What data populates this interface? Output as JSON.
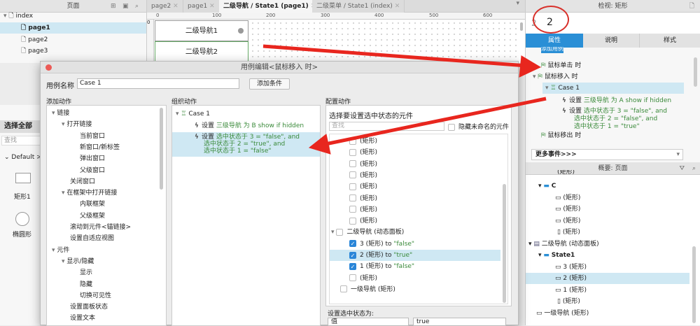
{
  "pages_panel": {
    "title": "页面",
    "tree": [
      {
        "label": "index"
      },
      {
        "label": "page1"
      },
      {
        "label": "page2"
      },
      {
        "label": "page3"
      }
    ]
  },
  "library_panel": {
    "select_all": "选择全部",
    "search_placeholder": "查找",
    "library": "Default >",
    "widgets": [
      {
        "label": "矩形1"
      },
      {
        "label": "椭圆形"
      }
    ]
  },
  "canvas": {
    "tabs": [
      {
        "label": "page2"
      },
      {
        "label": "page1"
      },
      {
        "label": "二级导航 / State1 (page1)"
      },
      {
        "label": "二级菜单 / State1 (index)"
      }
    ],
    "ruler": [
      "0",
      "100",
      "200",
      "300",
      "400",
      "500",
      "600"
    ],
    "v_ruler": "0",
    "widgets": [
      {
        "label": "二级导航1"
      },
      {
        "label": "二级导航2"
      }
    ]
  },
  "dialog": {
    "title": "用例编辑<鼠标移入 时>",
    "case_name_label": "用例名称",
    "case_name": "Case 1",
    "add_condition": "添加条件",
    "add_actions": {
      "title": "添加动作",
      "items": [
        "链接",
        "打开链接",
        "当前窗口",
        "新窗口/新标签",
        "弹出窗口",
        "父级窗口",
        "关闭窗口",
        "在框架中打开链接",
        "内联框架",
        "父级框架",
        "滚动到元件<锚链接>",
        "设置自适应视图",
        "元件",
        "显示/隐藏",
        "显示",
        "隐藏",
        "切换可见性",
        "设置面板状态",
        "设置文本"
      ]
    },
    "organize": {
      "title": "组织动作",
      "case": "Case 1",
      "actions": [
        {
          "verb": "设置",
          "text": "三级导航 为 B show if hidden"
        },
        {
          "verb": "设置",
          "lines": [
            "选中状态于 3 = \"false\", and",
            "选中状态于 2 = \"true\", and",
            "选中状态于 1 = \"false\""
          ]
        }
      ]
    },
    "configure": {
      "title": "配置动作",
      "subtitle": "选择要设置选中状态的元件",
      "search_placeholder": "查找",
      "hide_unnamed": "隐藏未命名的元件",
      "items": [
        {
          "label": "(矩形)"
        },
        {
          "label": "(矩形)"
        },
        {
          "label": "(矩形)"
        },
        {
          "label": "(矩形)"
        },
        {
          "label": "(矩形)"
        },
        {
          "label": "(矩形)"
        },
        {
          "label": "(矩形)"
        },
        {
          "label": "(矩形)"
        },
        {
          "label": "二级导航 (动态面板)"
        },
        {
          "label": "3 (矩形) to ",
          "value": "\"false\""
        },
        {
          "label": "2 (矩形) to ",
          "value": "\"true\""
        },
        {
          "label": "1 (矩形) to ",
          "value": "\"false\""
        },
        {
          "label": "(矩形)"
        },
        {
          "label": "一级导航 (矩形)"
        }
      ],
      "set_state_label": "设置选中状态为:",
      "select_type": "值",
      "select_value": "true"
    }
  },
  "inspector": {
    "title": "检视: 矩形",
    "name_prefix": "2",
    "name": "2",
    "tabs": [
      "属性",
      "说明",
      "样式"
    ],
    "add_case": "添加用例",
    "events": [
      {
        "label": "鼠标单击 时"
      },
      {
        "label": "鼠标移入 时"
      }
    ],
    "case": "Case 1",
    "actions": [
      {
        "verb": "设置",
        "text": "三级导航 为 A show if hidden"
      },
      {
        "verb": "设置",
        "lines": [
          "选中状态于 3 = \"false\", and",
          "选中状态于 2 = \"false\", and",
          "选中状态于 1 = \"true\""
        ]
      }
    ],
    "event_out": "鼠标移出 时",
    "more_events": "更多事件>>>"
  },
  "outline": {
    "title": "概要: 页面",
    "items": [
      "(矩形)",
      "C",
      "(矩形)",
      "(矩形)",
      "(矩形)",
      "(矩形)",
      "二级导航 (动态面板)",
      "State1",
      "3 (矩形)",
      "2 (矩形)",
      "1 (矩形)",
      "(矩形)",
      "一级导航 (矩形)"
    ]
  },
  "colors": {
    "accent": "#2a8fd6",
    "selection": "#cfe8f3",
    "green": "#3a8a3a",
    "arrow": "#e8261e"
  }
}
